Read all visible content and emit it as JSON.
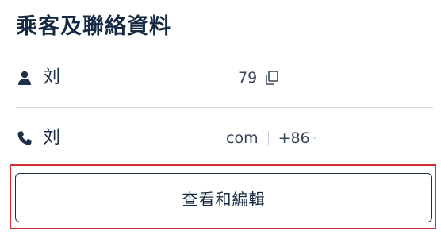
{
  "section": {
    "title": "乘客及聯絡資料"
  },
  "passenger": {
    "name": "刘",
    "name_tail": "·",
    "id_number": "79",
    "icon": "person-icon",
    "copy_icon": "copy-icon"
  },
  "contact": {
    "name": "刘",
    "email": "com",
    "phone": "+86",
    "phone_tail": "·",
    "icon": "phone-icon"
  },
  "actions": {
    "edit_label": "查看和編輯"
  },
  "colors": {
    "text": "#172a44",
    "border": "#1f2f46",
    "highlight": "#d32f2f",
    "divider": "#d7dbe0"
  }
}
